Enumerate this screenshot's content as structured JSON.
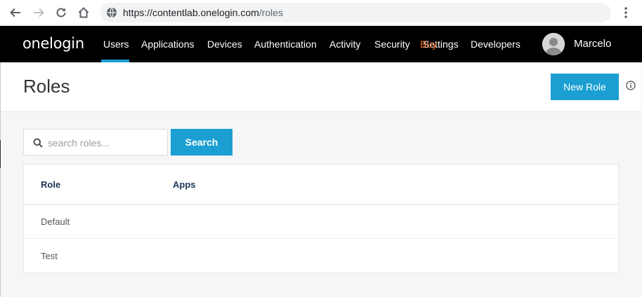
{
  "browser": {
    "url_host": "https://contentlab.onelogin.com",
    "url_path": "/roles"
  },
  "app": {
    "logo": "onelogin",
    "nav": [
      "Users",
      "Applications",
      "Devices",
      "Authentication",
      "Activity",
      "Security",
      "Settings",
      "Developers"
    ],
    "active_nav": "Users",
    "overlay_label": "Buy",
    "accent_color": "#1b9fd2",
    "user": {
      "name": "Marcelo"
    }
  },
  "page": {
    "title": "Roles",
    "new_role_label": "New Role"
  },
  "search": {
    "placeholder": "search roles...",
    "value": "",
    "button_label": "Search"
  },
  "table": {
    "columns": [
      "Role",
      "Apps"
    ],
    "rows": [
      {
        "role": "Default",
        "apps": ""
      },
      {
        "role": "Test",
        "apps": ""
      }
    ]
  }
}
